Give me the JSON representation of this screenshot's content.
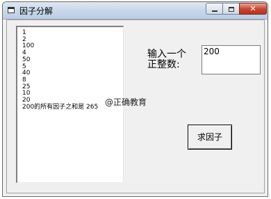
{
  "window": {
    "title": "因子分解"
  },
  "list": {
    "items": [
      "1",
      "2",
      "100",
      "4",
      "50",
      "5",
      "40",
      "8",
      "25",
      "10",
      "20",
      "200的所有因子之和是 265"
    ]
  },
  "form": {
    "prompt_line1": "输入一个",
    "prompt_line2": "正整数:",
    "input_value": "200",
    "button_label": "求因子"
  },
  "watermark": "@正确教育"
}
